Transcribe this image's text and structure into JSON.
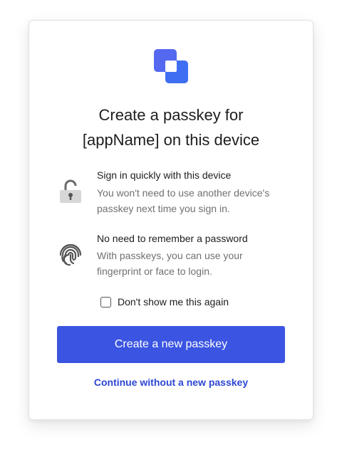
{
  "dialog": {
    "title_line1": "Create a passkey for",
    "title_line2": "[appName] on this device",
    "logo_icon": "app-logo-icon",
    "accent_color": "#3b55e2",
    "features": [
      {
        "icon": "unlocked-padlock-icon",
        "title": "Sign in quickly with this device",
        "desc_line1": "You won't need to use another device's",
        "desc_line2": "passkey next time you sign in."
      },
      {
        "icon": "fingerprint-icon",
        "title": "No need to remember a password",
        "desc_line1": "With passkeys, you can use your",
        "desc_line2": "fingerprint or face to login."
      }
    ],
    "checkbox": {
      "label": "Don't show me this again",
      "checked": false
    },
    "primary_button": "Create a new passkey",
    "secondary_link": "Continue without a new passkey"
  }
}
